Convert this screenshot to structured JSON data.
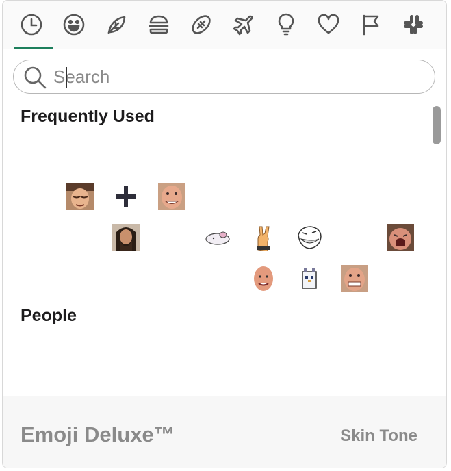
{
  "tabs": [
    {
      "name": "recent",
      "active": true
    },
    {
      "name": "smileys"
    },
    {
      "name": "nature"
    },
    {
      "name": "food"
    },
    {
      "name": "activity"
    },
    {
      "name": "travel"
    },
    {
      "name": "objects"
    },
    {
      "name": "symbols"
    },
    {
      "name": "flags"
    },
    {
      "name": "slack"
    }
  ],
  "accent_color": "#1d7f5c",
  "search": {
    "placeholder": "Search",
    "value": ""
  },
  "sections": {
    "frequently_used": "Frequently Used",
    "people": "People"
  },
  "emojis": [
    "sleeping-man-custom-emoji",
    "heavy-plus-sign-emoji",
    "grinning-man-custom-emoji",
    "bearded-man-custom-emoji",
    "sleeping-creature-custom-emoji",
    "sign-of-the-horns-emoji",
    "trollface-custom-emoji",
    "shouting-man-custom-emoji",
    "bald-man-custom-emoji",
    "pixel-bird-custom-emoji",
    "grimacing-man-custom-emoji"
  ],
  "footer": {
    "title": "Emoji Deluxe™",
    "skin_tone_label": "Skin Tone"
  }
}
